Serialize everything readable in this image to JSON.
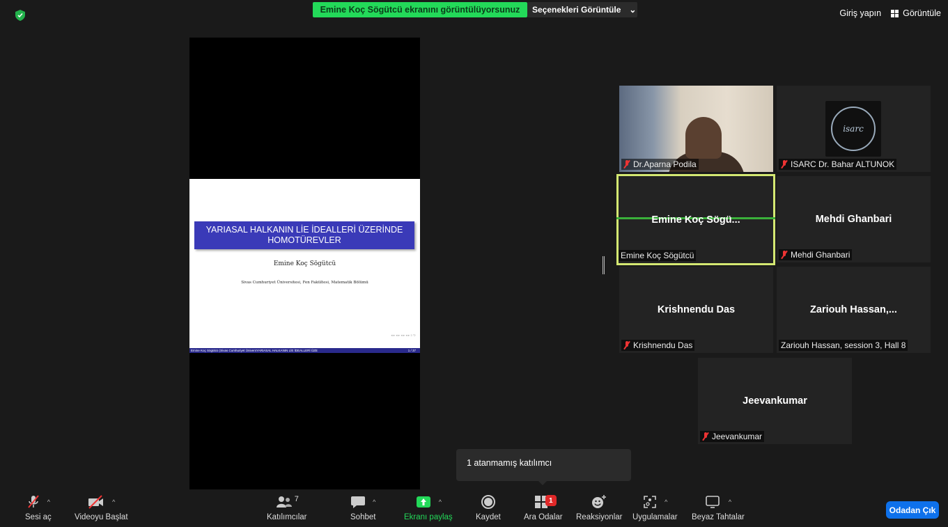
{
  "top": {
    "share_banner": "Emine Koç Sögütcü ekranını görüntülüyorsunuz",
    "view_options": "Seçenekleri Görüntüle",
    "login": "Giriş yapın",
    "view": "Görüntüle"
  },
  "slide": {
    "title": "YARIASAL HALKANIN LİE İDEALLERİ ÜZERİNDE HOMOTÜREVLER",
    "author": "Emine Koç Sögütcü",
    "institution": "Sivas Cumhuriyet Üniversitesi, Fen Fakültesi, Matematik Bölümü",
    "footer_left": "Emine Koç Sögütcü (Sivas Cumhuriyet Ünivers",
    "footer_mid": "YARIASAL HALKANIN LİE İDEALLERİ ÜZE",
    "page": "1 / 37"
  },
  "participants": {
    "p1": "Dr.Aparna Podila",
    "p2": "ISARC Dr. Bahar ALTUNOK",
    "p2_logo": "isarc",
    "p3_big": "Emine Koç Sögü...",
    "p3": "Emine Koç Sögütcü",
    "p4_big": "Mehdi Ghanbari",
    "p4": "Mehdi Ghanbari",
    "p5_big": "Krishnendu Das",
    "p5": "Krishnendu Das",
    "p6_big": "Zariouh Hassan,...",
    "p6": "Zariouh Hassan, session 3, Hall 8",
    "p7_big": "Jeevankumar",
    "p7": "Jeevankumar"
  },
  "tooltip": "1 atanmamış katılımcı",
  "toolbar": {
    "unmute": "Sesi aç",
    "start_video": "Videoyu Başlat",
    "participants": "Katılımcılar",
    "participants_count": "7",
    "chat": "Sohbet",
    "share": "Ekranı paylaş",
    "record": "Kaydet",
    "breakout": "Ara Odalar",
    "breakout_badge": "1",
    "reactions": "Reaksiyonlar",
    "apps": "Uygulamalar",
    "whiteboard": "Beyaz Tahtalar",
    "leave": "Odadan Çık"
  },
  "colors": {
    "share_green": "#23d959",
    "active_speaker": "#d4e872",
    "leave_blue": "#0e71eb",
    "muted_red": "#ee3333"
  }
}
